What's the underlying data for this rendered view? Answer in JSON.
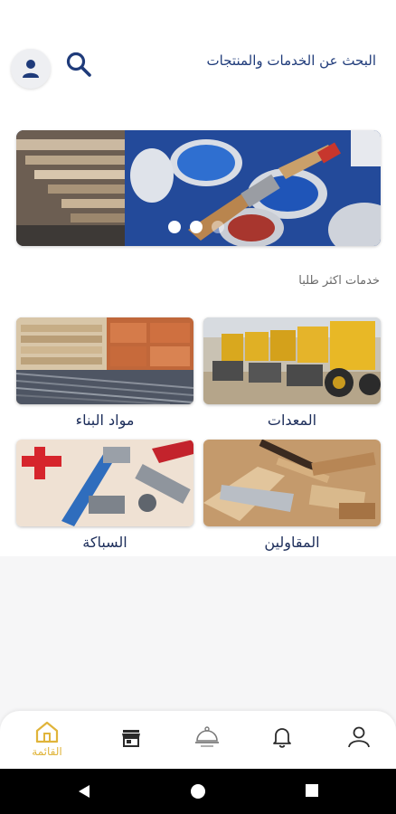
{
  "header": {
    "search_text": "البحث عن الخدمات والمنتجات"
  },
  "banner": {
    "slides_count": 3,
    "active_slide": 1
  },
  "section": {
    "title": "خدمات اكثر طلبا"
  },
  "categories": [
    {
      "label": "مواد البناء"
    },
    {
      "label": "المعدات"
    },
    {
      "label": "السباكة"
    },
    {
      "label": "المقاولين"
    }
  ],
  "nav": {
    "home_label": "القائمة",
    "active_color": "#e0b43a",
    "inactive_color": "#2b2b2b"
  },
  "icons": [
    "user-icon",
    "search-icon",
    "home-icon",
    "store-icon",
    "service-tray-icon",
    "bell-icon",
    "profile-icon",
    "back-icon",
    "home-circle-icon",
    "recents-icon"
  ]
}
